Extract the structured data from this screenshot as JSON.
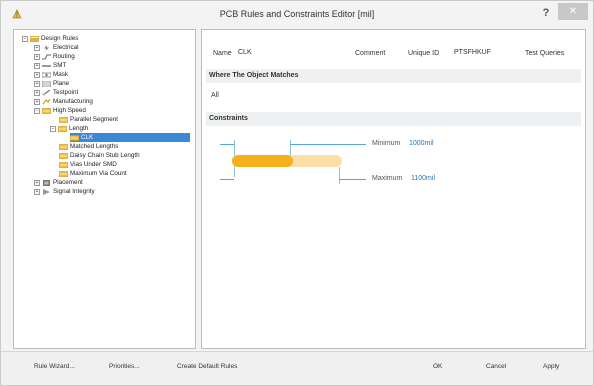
{
  "window": {
    "title": "PCB Rules and Constraints Editor [mil]",
    "help_glyph": "?",
    "close_glyph": "✕"
  },
  "tree": {
    "items": [
      {
        "label": "Design Rules",
        "icon": "design-rules-icon",
        "expander": "⊟",
        "level": 0
      },
      {
        "label": "Electrical",
        "icon": "electrical-icon",
        "expander": "⊞",
        "level": 1
      },
      {
        "label": "Routing",
        "icon": "routing-icon",
        "expander": "⊞",
        "level": 1
      },
      {
        "label": "SMT",
        "icon": "smt-icon",
        "expander": "⊞",
        "level": 1
      },
      {
        "label": "Mask",
        "icon": "mask-icon",
        "expander": "⊞",
        "level": 1
      },
      {
        "label": "Plane",
        "icon": "plane-icon",
        "expander": "⊞",
        "level": 1
      },
      {
        "label": "Testpoint",
        "icon": "testpoint-icon",
        "expander": "⊞",
        "level": 1
      },
      {
        "label": "Manufacturing",
        "icon": "manufacturing-icon",
        "expander": "⊞",
        "level": 1
      },
      {
        "label": "High Speed",
        "icon": "high-speed-icon",
        "expander": "⊟",
        "level": 1
      },
      {
        "label": "Parallel Segment",
        "icon": "rule-icon",
        "expander": "",
        "level": 2
      },
      {
        "label": "Length",
        "icon": "rule-icon",
        "expander": "⊟",
        "level": 2
      },
      {
        "label": "CLK",
        "icon": "rule-icon",
        "expander": "",
        "level": 3,
        "selected": true
      },
      {
        "label": "Matched Lengths",
        "icon": "rule-icon",
        "expander": "",
        "level": 2
      },
      {
        "label": "Daisy Chain Stub Length",
        "icon": "rule-icon",
        "expander": "",
        "level": 2
      },
      {
        "label": "Vias Under SMD",
        "icon": "rule-icon",
        "expander": "",
        "level": 2
      },
      {
        "label": "Maximum Via Count",
        "icon": "rule-icon",
        "expander": "",
        "level": 2
      },
      {
        "label": "Placement",
        "icon": "placement-icon",
        "expander": "⊞",
        "level": 1
      },
      {
        "label": "Signal Integrity",
        "icon": "signal-integrity-icon",
        "expander": "⊞",
        "level": 1
      }
    ]
  },
  "rule": {
    "name_label": "Name",
    "name_value": "CLK",
    "comment_label": "Comment",
    "unique_id_label": "Unique ID",
    "unique_id_value": "PTSFHKUF",
    "test_queries_label": "Test Queries"
  },
  "where": {
    "heading": "Where The Object Matches",
    "value": "All"
  },
  "constraints": {
    "heading": "Constraints",
    "min_label": "Minimum",
    "min_value": "1000mil",
    "max_label": "Maximum",
    "max_value": "1100mil",
    "bar_fill_fraction": 0.55,
    "colors": {
      "bar_fill": "#f4b11d",
      "bar_range": "#fbdfa6",
      "dimension": "#5aa4d0"
    }
  },
  "footer": {
    "rule_wizard": "Rule Wizard...",
    "priorities": "Priorities...",
    "create_default": "Create Default Rules",
    "ok": "OK",
    "cancel": "Cancel",
    "apply": "Apply"
  }
}
